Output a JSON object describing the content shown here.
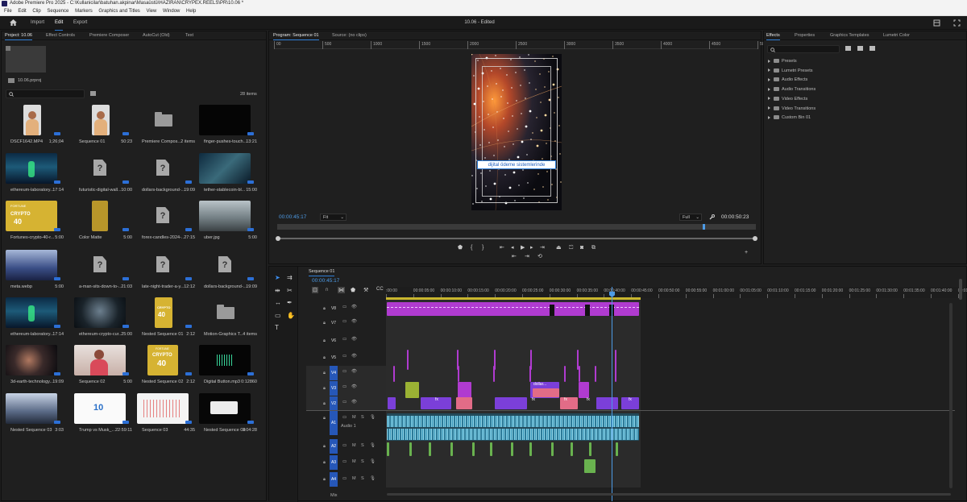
{
  "window": {
    "title": "Adobe Premiere Pro 2025 - C:\\Kullanicilar\\batuhan.akpinar\\Masaüstü\\HAZİRAN\\CRYPEX.REELS\\PR\\10.06 *"
  },
  "menu": [
    "File",
    "Edit",
    "Clip",
    "Sequence",
    "Markers",
    "Graphics and Titles",
    "View",
    "Window",
    "Help"
  ],
  "workspace": {
    "tabs": [
      "Import",
      "Edit",
      "Export"
    ],
    "active": "Edit",
    "document_title": "10.06 - Edited"
  },
  "project_panel": {
    "tabs": [
      "Project: 10.06",
      "Effect Controls",
      "Premiere Composer",
      "AutoCut (Old)",
      "Text"
    ],
    "project_file": "10.06.prproj",
    "search_placeholder": "",
    "item_count": "28 items",
    "items": [
      {
        "name": "DSCF1642.MP4",
        "value": "1;26;04",
        "kind": "video-person"
      },
      {
        "name": "Sequence 01",
        "value": "50:23",
        "kind": "video-person"
      },
      {
        "name": "Premiere Compos...",
        "value": "2 items",
        "kind": "folder"
      },
      {
        "name": "finger-pushes-touch...",
        "value": "13:21",
        "kind": "black"
      },
      {
        "name": "ethereum-laboratory...",
        "value": "17:14",
        "kind": "tech"
      },
      {
        "name": "futuristic-digital-wall...",
        "value": "10:00",
        "kind": "missing"
      },
      {
        "name": "dollars-background-...",
        "value": "19:09",
        "kind": "missing"
      },
      {
        "name": "tether-stablecoin-bl...",
        "value": "15:00",
        "kind": "tech2"
      },
      {
        "name": "Fortunes-crypto-40-r...",
        "value": "5:00",
        "kind": "crypto"
      },
      {
        "name": "Color Matte",
        "value": "5:00",
        "kind": "matte"
      },
      {
        "name": "forex-candles-2024-...",
        "value": "27:15",
        "kind": "missing"
      },
      {
        "name": "uber.jpg",
        "value": "5:00",
        "kind": "city"
      },
      {
        "name": "meta.webp",
        "value": "5:00",
        "kind": "building"
      },
      {
        "name": "a-man-sits-down-to-...",
        "value": "21:03",
        "kind": "missing"
      },
      {
        "name": "late-night-trader-a-y...",
        "value": "12:12",
        "kind": "missing"
      },
      {
        "name": "dollars-background-...",
        "value": "19:09",
        "kind": "missing"
      },
      {
        "name": "ethereum-laboratory...",
        "value": "17:14",
        "kind": "tech"
      },
      {
        "name": "ethereum-crypto-cur...",
        "value": "25:00",
        "kind": "dark"
      },
      {
        "name": "Nested Sequence 01",
        "value": "2:12",
        "kind": "crypto-small"
      },
      {
        "name": "Motion-Graphics T...",
        "value": "4 items",
        "kind": "folder"
      },
      {
        "name": "3d-earth-technology...",
        "value": "19:09",
        "kind": "earth"
      },
      {
        "name": "Sequence 02",
        "value": "5:00",
        "kind": "woman"
      },
      {
        "name": "Nested Sequence 02",
        "value": "2:12",
        "kind": "crypto40"
      },
      {
        "name": "Digital Button.mp3",
        "value": "0:12860",
        "kind": "audio"
      },
      {
        "name": "Nested Sequence 03",
        "value": "3:03",
        "kind": "building2"
      },
      {
        "name": "Trump vs Musk_...",
        "value": "22:59:11",
        "kind": "white10"
      },
      {
        "name": "Sequence 03",
        "value": "44:35",
        "kind": "chart"
      },
      {
        "name": "Nested Sequence 04",
        "value": "1:04:28",
        "kind": "blackcard"
      }
    ],
    "thumb_text": {
      "fortune": "FORTUNE",
      "crypto": "CRYPTO",
      "forty": "40",
      "ten": "10"
    }
  },
  "program_monitor": {
    "tabs": [
      "Program: Sequence 01",
      "Source: (no clips)"
    ],
    "ruler": [
      "00",
      "500",
      "1000",
      "1500",
      "2000",
      "2500",
      "3000",
      "3500",
      "4000",
      "4500",
      "5000"
    ],
    "caption": "dijital ödeme sistemlerinde",
    "timecode_left": "00:00:45:17",
    "fit": "Fit",
    "quality": "Full",
    "timecode_right": "00:00:50:23"
  },
  "effects_panel": {
    "tabs": [
      "Effects",
      "Properties",
      "Graphics Templates",
      "Lumetri Color"
    ],
    "items": [
      "Presets",
      "Lumetri Presets",
      "Audio Effects",
      "Audio Transitions",
      "Video Effects",
      "Video Transitions",
      "Custom Bin 01"
    ]
  },
  "timeline": {
    "tab": "Sequence 01",
    "timecode": "00:00:45:17",
    "ruler": [
      ":00:00",
      "00:00:05:00",
      "00:00:10:00",
      "00:00:15:00",
      "00:00:20:00",
      "00:00:25:00",
      "00:00:30:00",
      "00:00:35:00",
      "00:00:40:00",
      "00:00:45:00",
      "00:00:50:00",
      "00:00:55:00",
      "00:01:00:00",
      "00:01:05:00",
      "00:01:10:00",
      "00:01:15:00",
      "00:01:20:00",
      "00:01:25:00",
      "00:01:30:00",
      "00:01:35:00",
      "00:01:40:00",
      "00:01:45:00"
    ],
    "video_tracks": [
      "V8",
      "V7",
      "V6",
      "V5",
      "V4",
      "V3",
      "V2",
      "V1"
    ],
    "audio_tracks": [
      "A1",
      "A2",
      "A3",
      "A4"
    ],
    "audio1_label": "Audio 1",
    "mix_label": "Mix",
    "mix_value": "0.0",
    "clip_label": "dollar...",
    "fx_label": "fx"
  },
  "colors": {
    "accent": "#2f7fd8",
    "timecode": "#4d9be6",
    "clip_magenta": "#b03bd0",
    "clip_purple": "#7b3fd9",
    "clip_pink": "#e26c87",
    "clip_audio": "#56b9d8",
    "playhead": "#4d9be6"
  }
}
